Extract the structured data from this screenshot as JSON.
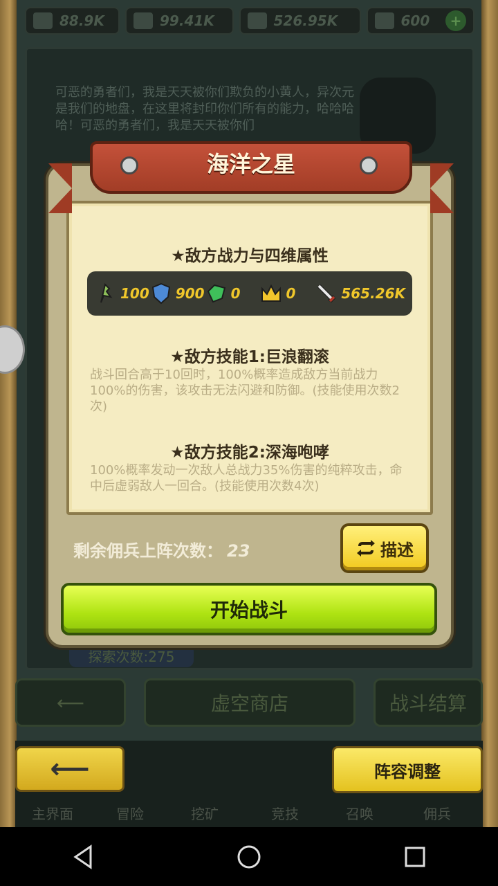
{
  "resources": [
    {
      "icon": "sword-resource-icon",
      "value": "88.9K"
    },
    {
      "icon": "exp-resource-icon",
      "value": "99.41K"
    },
    {
      "icon": "gold-coin-icon",
      "value": "526.95K"
    },
    {
      "icon": "gem-icon",
      "value": "600"
    }
  ],
  "background": {
    "story": "可恶的勇者们，我是天天被你们欺负的小黄人，异次元是我们的地盘，在这里将封印你们所有的能力，哈哈哈哈！可恶的勇者们，我是天天被你们",
    "void_shop": "虚空商店",
    "battle_settle": "战斗结算",
    "explore_count": "探索次数:275",
    "lineup_button": "阵容调整",
    "nav": [
      "主界面",
      "冒险",
      "挖矿",
      "竞技",
      "召唤",
      "佣兵"
    ]
  },
  "dialog": {
    "title": "海洋之星",
    "stats_heading": "★敌方战力与四维属性",
    "stats": [
      {
        "icon": "agility-icon",
        "value": "100"
      },
      {
        "icon": "shield-icon",
        "value": "900"
      },
      {
        "icon": "emerald-icon",
        "value": "0"
      },
      {
        "icon": "crown-icon",
        "value": "0"
      },
      {
        "icon": "sword-icon",
        "value": "565.26K"
      }
    ],
    "skill1": {
      "heading": "★敌方技能1:巨浪翻滚",
      "desc": "战斗回合高于10回时，100%概率造成敌方当前战力100%的伤害，该攻击无法闪避和防御。(技能使用次数2次)"
    },
    "skill2": {
      "heading": "★敌方技能2:深海咆哮",
      "desc": "100%概率发动一次敌人总战力35%伤害的纯粹攻击，命中后虚弱敌人一回合。(技能使用次数4次)"
    },
    "remaining_label": "剩余佣兵上阵次数：",
    "remaining_value": "23",
    "describe_button": "描述",
    "start_button": "开始战斗"
  },
  "colors": {
    "ribbon": "#b4472f",
    "paper": "#f5ecc2",
    "start_button": "#aee312",
    "describe_button": "#f2c91d",
    "stat_value": "#f0c72b"
  }
}
